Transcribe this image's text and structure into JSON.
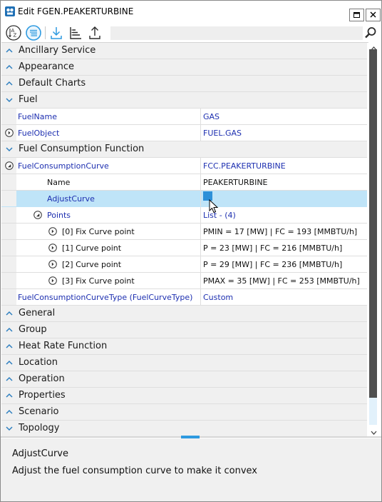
{
  "window": {
    "title": "Edit FGEN.PEAKERTURBINE"
  },
  "toolbar": {
    "tools": [
      {
        "name": "sort-alphabetical",
        "icon": "az-sort-icon"
      },
      {
        "name": "categorized",
        "icon": "list-lines-icon",
        "active": true
      },
      {
        "name": "import",
        "icon": "download-icon"
      },
      {
        "name": "sort-tree",
        "icon": "tree-sort-icon"
      },
      {
        "name": "export",
        "icon": "upload-icon"
      }
    ],
    "search": {
      "value": "",
      "placeholder": ""
    }
  },
  "grid": {
    "categories": {
      "ancillary": "Ancillary Service",
      "appearance": "Appearance",
      "default_charts": "Default Charts",
      "fuel": "Fuel",
      "fcf": "Fuel Consumption Function",
      "general": "General",
      "group": "Group",
      "heat_rate": "Heat Rate Function",
      "location": "Location",
      "operation": "Operation",
      "properties": "Properties",
      "scenario": "Scenario",
      "topology": "Topology"
    },
    "fuel": {
      "fuel_name": {
        "name": "FuelName",
        "value": "GAS"
      },
      "fuel_object": {
        "name": "FuelObject",
        "value": "FUEL.GAS"
      }
    },
    "fcf": {
      "curve": {
        "name": "FuelConsumptionCurve",
        "value": "FCC.PEAKERTURBINE"
      },
      "curve_name": {
        "name": "Name",
        "value": "PEAKERTURBINE"
      },
      "adjust": {
        "name": "AdjustCurve",
        "value": ""
      },
      "points": {
        "name": "Points",
        "value": "List - (4)"
      },
      "p0": {
        "name": "[0]  Fix Curve point",
        "value": "PMIN = 17 [MW] | FC = 193 [MMBTU/h]"
      },
      "p1": {
        "name": "[1]  Curve point",
        "value": "P = 23 [MW] |  FC = 216 [MMBTU/h]"
      },
      "p2": {
        "name": "[2]  Curve point",
        "value": "P = 29 [MW] |  FC = 236 [MMBTU/h]"
      },
      "p3": {
        "name": "[3]  Fix Curve point",
        "value": "PMAX = 35 [MW] | FC = 253 [MMBTU/h]"
      },
      "curve_type": {
        "name": "FuelConsumptionCurveType (FuelCurveType)",
        "value": "Custom"
      }
    }
  },
  "description": {
    "title": "AdjustCurve",
    "text": "Adjust the fuel consumption curve to make it convex"
  },
  "colors": {
    "accent": "#2e9ae0",
    "selected_row": "#bfe4f8",
    "property_blue": "#1d2fb0",
    "category_bg": "#f0f0f0"
  }
}
